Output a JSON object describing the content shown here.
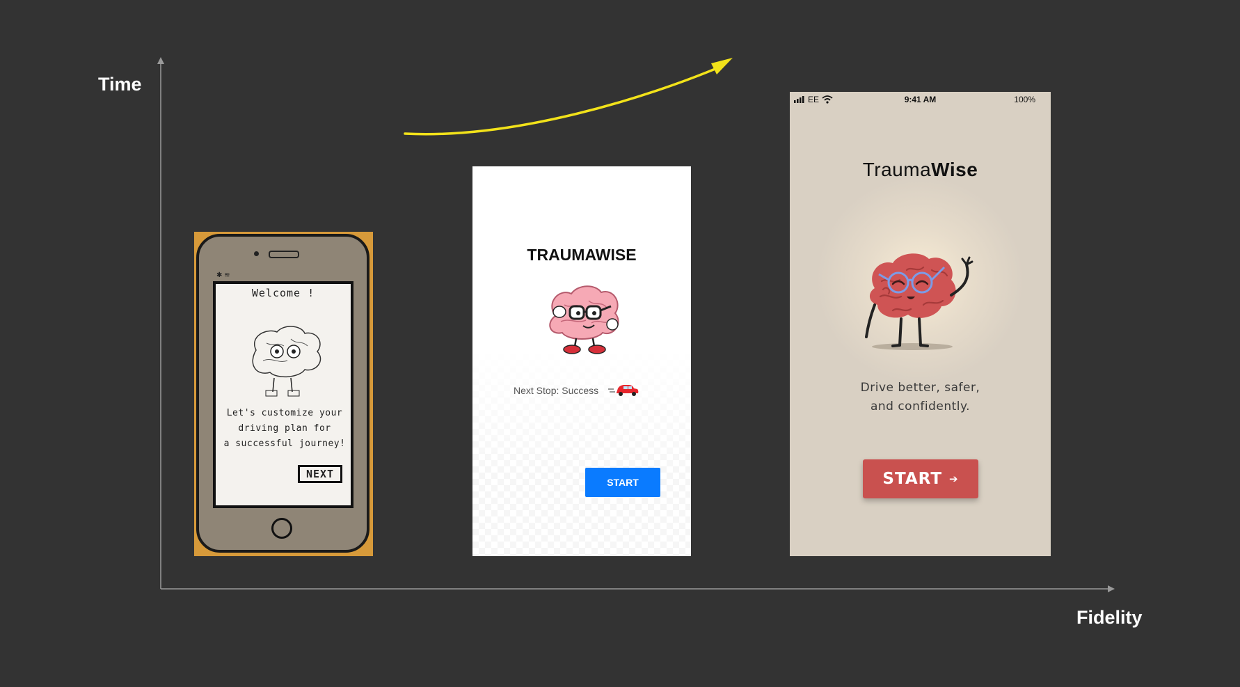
{
  "axes": {
    "y_label": "Time",
    "x_label": "Fidelity",
    "trend_arrow_color": "#f2e21a"
  },
  "paper_prototype": {
    "welcome": "Welcome !",
    "body": "Let's customize your\ndriving plan for\na successful journey!",
    "next_label": "NEXT"
  },
  "midfi_prototype": {
    "title": "TRAUMAWISE",
    "tagline": "Next Stop: Success",
    "start_label": "START",
    "accent": "#0a7bff"
  },
  "hifi_prototype": {
    "status": {
      "carrier": "EE",
      "time": "9:41 AM",
      "battery": "100%"
    },
    "title_light": "Trauma",
    "title_bold": "Wise",
    "tagline_line1": "Drive better, safer,",
    "tagline_line2": "and confidently.",
    "start_label": "START",
    "accent": "#c9514f",
    "background": "#d9d0c3"
  }
}
